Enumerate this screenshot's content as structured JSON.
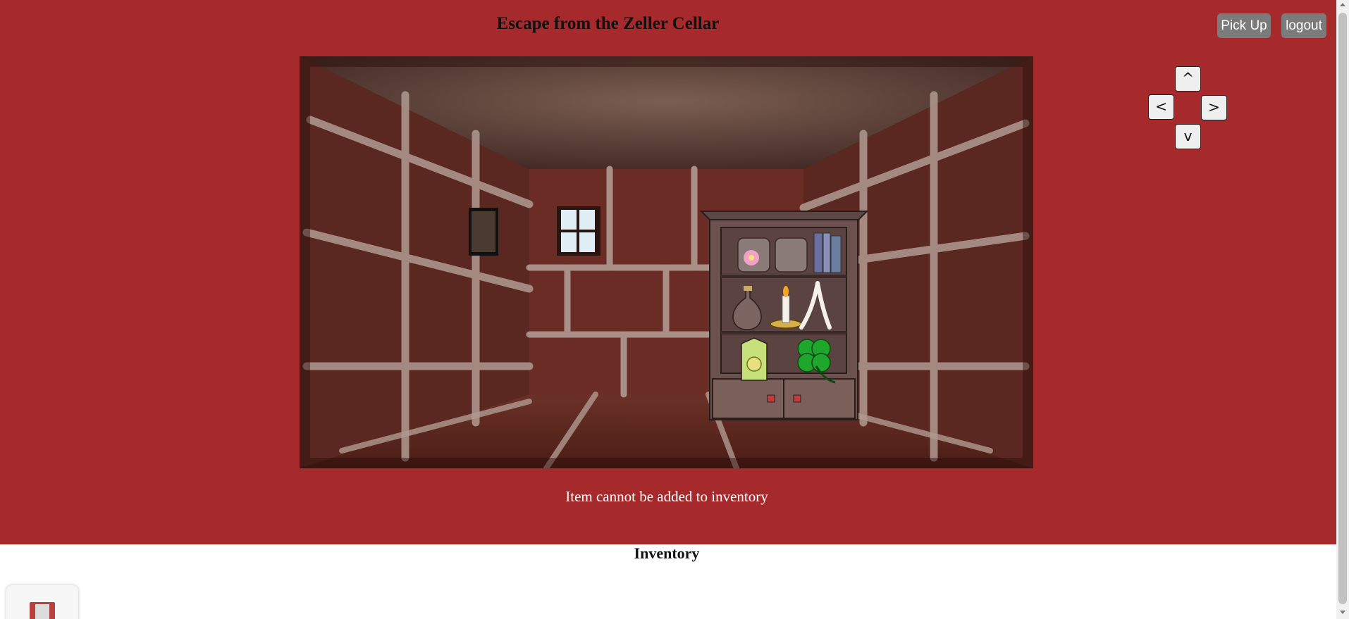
{
  "header": {
    "title": "Escape from the Zeller Cellar",
    "pickup_label": "Pick Up",
    "logout_label": "logout"
  },
  "nav": {
    "up": "^",
    "left": "<",
    "right": ">",
    "down": "v"
  },
  "message": "Item cannot be added to inventory",
  "inventory": {
    "title": "Inventory",
    "items": [
      {
        "icon": "book-icon"
      }
    ]
  },
  "colors": {
    "background": "#a62a2b",
    "button": "#7b7b7b"
  }
}
